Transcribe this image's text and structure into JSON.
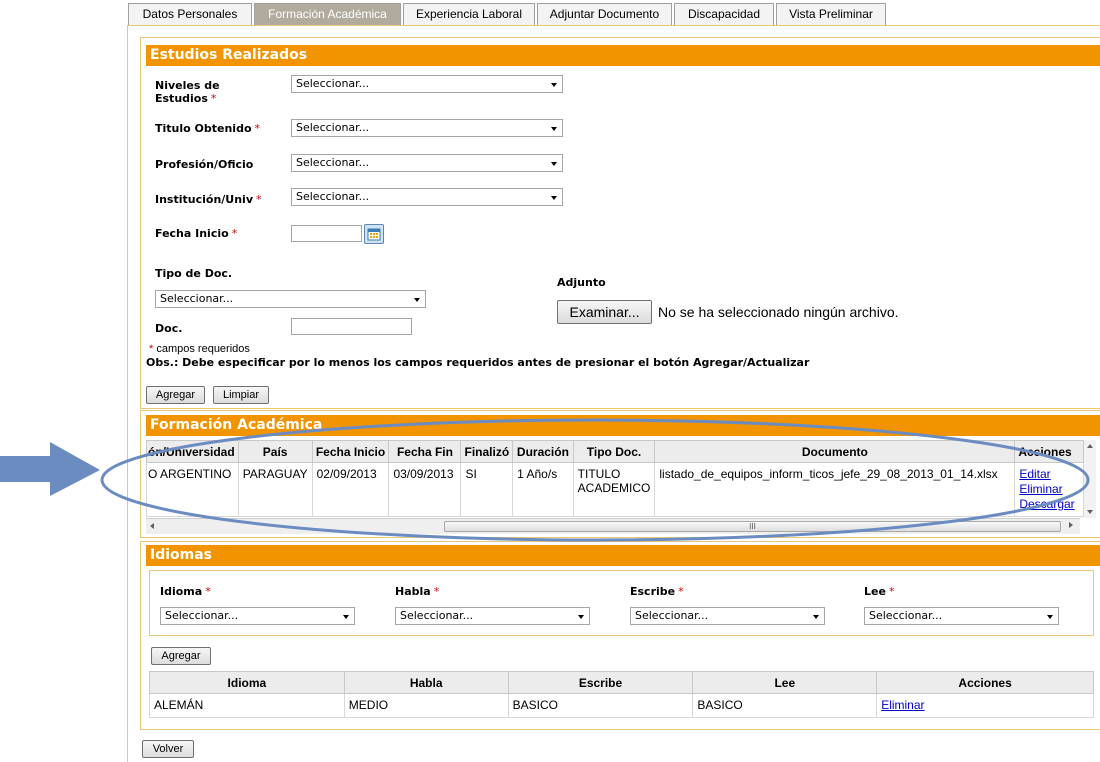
{
  "tabs": [
    "Datos Personales",
    "Formación Académica",
    "Experiencia Laboral",
    "Adjuntar Documento",
    "Discapacidad",
    "Vista Preliminar"
  ],
  "estudios": {
    "title": "Estudios Realizados",
    "niveles_label_1": "Niveles de",
    "niveles_label_2": "Estudios",
    "titulo_label": "Titulo Obtenido",
    "profesion_label": "Profesión/Oficio",
    "institucion_label": "Institución/Univ",
    "fecha_inicio_label": "Fecha Inicio",
    "tipo_doc_label": "Tipo de Doc.",
    "doc_label": "Doc.",
    "adjunto_label": "Adjunto",
    "select_placeholder": "Seleccionar...",
    "examinar_label": "Examinar...",
    "no_file_text": "No se ha seleccionado ningún archivo.",
    "req_mark": "*",
    "req_note": "campos requeridos",
    "obs_note": "Obs.: Debe especificar por lo menos los campos requeridos antes de presionar el botón Agregar/Actualizar",
    "agregar_label": "Agregar",
    "limpiar_label": "Limpiar"
  },
  "formacion": {
    "title": "Formación Académica",
    "headers": [
      "ón/Universidad",
      "País",
      "Fecha Inicio",
      "Fecha Fin",
      "Finalizó",
      "Duración",
      "Tipo Doc.",
      "Documento",
      "Acciones"
    ],
    "row": {
      "universidad": "O ARGENTINO",
      "pais": "PARAGUAY",
      "fecha_inicio": "02/09/2013",
      "fecha_fin": "03/09/2013",
      "finalizo": "SI",
      "duracion": "1 Año/s",
      "tipo_doc_1": "TITULO",
      "tipo_doc_2": "ACADEMICO",
      "documento": "listado_de_equipos_inform_ticos_jefe_29_08_2013_01_14.xlsx",
      "editar": "Editar",
      "eliminar": "Eliminar",
      "descargar": "Descargar"
    },
    "scroll_grip": "III"
  },
  "idiomas": {
    "title": "Idiomas",
    "idioma_label": "Idioma",
    "habla_label": "Habla",
    "escribe_label": "Escribe",
    "lee_label": "Lee",
    "select_placeholder": "Seleccionar...",
    "agregar_label": "Agregar",
    "headers": [
      "Idioma",
      "Habla",
      "Escribe",
      "Lee",
      "Acciones"
    ],
    "row": {
      "idioma": "ALEMÁN",
      "habla": "MEDIO",
      "escribe": "BASICO",
      "lee": "BASICO",
      "accion": "Eliminar"
    }
  },
  "volver_label": "Volver",
  "annotation": {
    "arrow_color": "#6b8cc0",
    "ellipse_color": "#6b8cc0"
  }
}
